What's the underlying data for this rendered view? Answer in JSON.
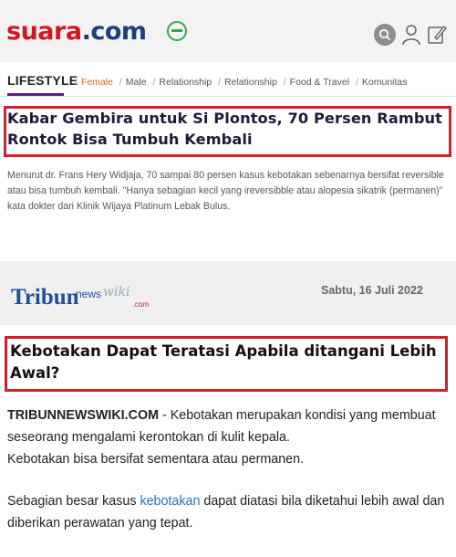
{
  "suara": {
    "logo": {
      "brand": "suara",
      "tld": ".com"
    },
    "nav": {
      "section": "LIFESTYLE",
      "items": [
        "Female",
        "Male",
        "Relationship",
        "Relationship",
        "Food & Travel",
        "Komunitas"
      ]
    },
    "title": "Kabar Gembira untuk Si Plontos, 70 Persen Rambut Rontok Bisa Tumbuh Kembali",
    "lead": "Menurut dr. Frans Hery Widjaja, 70 sampai 80 persen kasus kebotakan sebenarnya bersifat reversible atau bisa tumbuh kembali. \"Hanya sebagian kecil yang ireversibble atau alopesia sikatrik (permanen)\" kata dokter dari Klinik Wijaya Platinum Lebak Bulus."
  },
  "tribun": {
    "logo_text": {
      "tribun": "Tribun",
      "news": "news",
      "wiki": "wiki",
      "dotcom": ".com"
    },
    "date": "Sabtu, 16 Juli 2022",
    "title": "Kebotakan Dapat Teratasi Apabila ditangani Lebih Awal?",
    "p1_source": "TRIBUNNEWSWIKI.COM",
    "p1_text": " - Kebotakan merupakan kondisi yang membuat seseorang mengalami kerontokan di kulit kepala.",
    "p2": "Kebotakan bisa bersifat sementara atau permanen.",
    "p3_before": "Sebagian besar kasus ",
    "p3_link": "kebotakan",
    "p3_after": " dapat diatasi bila diketahui lebih awal dan diberikan perawatan yang tepat."
  },
  "colors": {
    "suara_red": "#d6161d",
    "suara_navy": "#1a3f7a",
    "highlight_border": "#d0202a",
    "nav_active": "#e0641c",
    "link": "#2d6fb7"
  },
  "icons": [
    "search-icon",
    "user-icon",
    "edit-icon"
  ]
}
